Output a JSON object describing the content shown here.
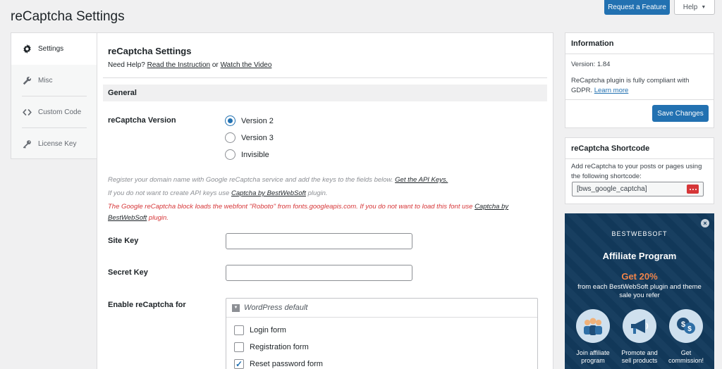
{
  "header": {
    "title": "reCaptcha Settings",
    "request_feature": "Request a Feature",
    "help": "Help"
  },
  "tabs": [
    {
      "label": "Settings",
      "icon": "gear-icon",
      "active": true
    },
    {
      "label": "Misc",
      "icon": "wrench-icon"
    },
    {
      "label": "Custom Code",
      "icon": "code-icon"
    },
    {
      "label": "License Key",
      "icon": "key-icon"
    }
  ],
  "main": {
    "title": "reCaptcha Settings",
    "need_help_prefix": "Need Help?",
    "read_instruction": "Read the Instruction",
    "or": "or",
    "watch_video": "Watch the Video",
    "section_general": "General",
    "version_label": "reCaptcha Version",
    "versions": [
      "Version 2",
      "Version 3",
      "Invisible"
    ],
    "selected_version": "Version 2",
    "note1_text": "Register your domain name with Google reCaptcha service and add the keys to the fields below.",
    "note1_link": "Get the API Keys.",
    "note2_text": "If you do not want to create API keys use",
    "note2_link": "Captcha by BestWebSoft",
    "note2_suffix": "plugin.",
    "note3_text": "The Google reCaptcha block loads the webfont \"Roboto\" from fonts.googleapis.com. If you do not want to load this font use",
    "note3_link": "Captcha by BestWebSoft",
    "note3_suffix": "plugin.",
    "site_key_label": "Site Key",
    "site_key_value": "",
    "secret_key_label": "Secret Key",
    "secret_key_value": "",
    "enable_label": "Enable reCaptcha for",
    "group_title": "WordPress default",
    "forms": [
      {
        "label": "Login form",
        "checked": false
      },
      {
        "label": "Registration form",
        "checked": false
      },
      {
        "label": "Reset password form",
        "checked": true
      }
    ]
  },
  "info": {
    "title": "Information",
    "version_label": "Version:",
    "version": "1.84",
    "gdpr_text": "ReCaptcha plugin is fully compliant with GDPR.",
    "learn_more": "Learn more",
    "save": "Save Changes"
  },
  "shortcode": {
    "title": "reCaptcha Shortcode",
    "text": "Add reCaptcha to your posts or pages using the following shortcode:",
    "value": "[bws_google_captcha]"
  },
  "promo": {
    "brand": "BESTWEBSOFT",
    "title": "Affiliate Program",
    "get": "Get 20%",
    "sub": "from each BestWebSoft plugin and theme sale you refer",
    "items": [
      {
        "label": "Join affiliate program",
        "icon": "people-icon"
      },
      {
        "label": "Promote and sell products",
        "icon": "megaphone-icon"
      },
      {
        "label": "Get commission!",
        "icon": "money-icon"
      }
    ]
  },
  "colors": {
    "accent": "#2271b1",
    "warning": "#d63638",
    "promo_bg": "#123a5c",
    "promo_highlight": "#f0844a"
  }
}
